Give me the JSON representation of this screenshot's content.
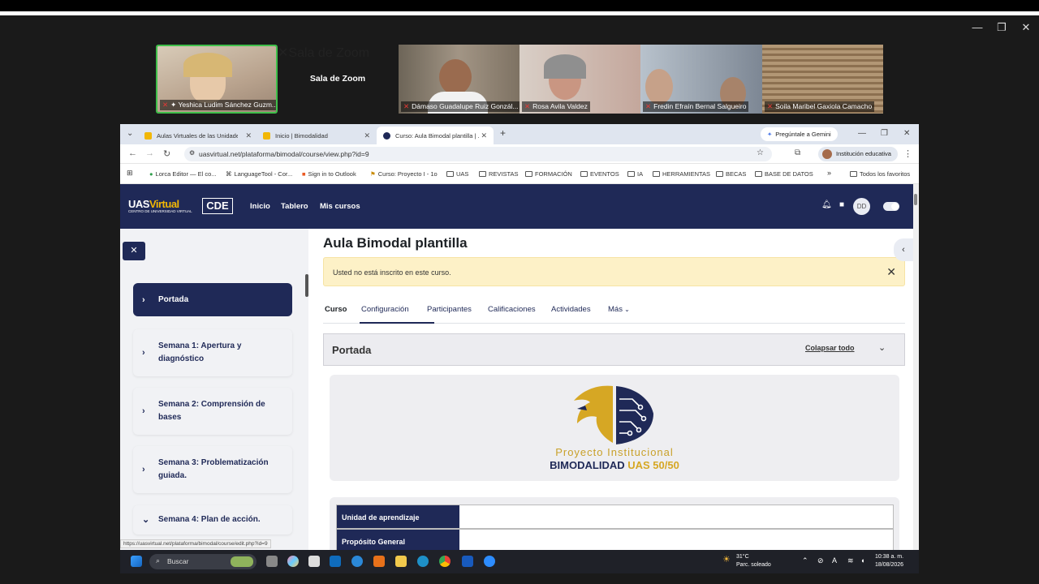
{
  "window_controls": {
    "minimize": "—",
    "restore": "❐",
    "close": "✕"
  },
  "zoom": {
    "room_label": "Sala de Zoom",
    "participants": [
      {
        "name": "Yeshica Ludim Sánchez Guzm...",
        "pinned": true,
        "active": true,
        "color": "#b9a38e"
      },
      {
        "name": "Sala de Zoom",
        "pinned": false,
        "active": false,
        "color": "#1a1a1a"
      },
      {
        "name": "Dámaso Guadalupe Ruiz Gonzál...",
        "pinned": false,
        "active": false,
        "color": "#8d7a66"
      },
      {
        "name": "Rosa Avila Valdez",
        "pinned": false,
        "active": false,
        "color": "#c4a79c"
      },
      {
        "name": "Fredin Efraín Bernal Salgueiro",
        "pinned": false,
        "active": false,
        "color": "#7d8794"
      },
      {
        "name": "Soila Maribel Gaxiola Camacho",
        "pinned": false,
        "active": false,
        "color": "#a08363"
      }
    ]
  },
  "browser": {
    "tabs": [
      {
        "label": "Aulas Virtuales de las Unidades"
      },
      {
        "label": "Inicio | Bimodalidad"
      },
      {
        "label": "Curso: Aula Bimodal plantilla | ..."
      }
    ],
    "new_tab": "+",
    "gemini": "Pregúntale a Gemini",
    "url": "uasvirtual.net/plataforma/bimodal/course/view.php?id=9",
    "profile": "Institución educativa",
    "bookmarks": [
      "Lorca Editor — El co...",
      "LanguageTool - Cor...",
      "Sign in to Outlook",
      "Curso: Proyecto I - 1o",
      "UAS",
      "REVISTAS",
      "FORMACIÓN",
      "EVENTOS",
      "IA",
      "HERRAMIENTAS",
      "BECAS",
      "BASE DE DATOS"
    ],
    "bookmarks_more": "»",
    "all_favorites": "Todos los favoritos",
    "status_url": "https://uasvirtual.net/plataforma/bimodal/course/edit.php?id=9"
  },
  "moodle": {
    "logo_main": "UAS",
    "logo_virtual": "Virtual",
    "logo_sub": "CENTRO DE UNIVERSIDAD VIRTUAL",
    "logo_cde": "CDE",
    "nav": [
      "Inicio",
      "Tablero",
      "Mis cursos"
    ],
    "user_initials": "DD",
    "course_title": "Aula Bimodal plantilla",
    "notice": "Usted no está inscrito en este curso.",
    "course_tabs": [
      "Curso",
      "Configuración",
      "Participantes",
      "Calificaciones",
      "Actividades",
      "Más"
    ],
    "section_title": "Portada",
    "collapse_all": "Colapsar todo",
    "banner_line1": "Proyecto Institucional",
    "banner_line2a": "BIMODALIDAD",
    "banner_line2b": "UAS 50/50",
    "table_rows": [
      "Unidad de aprendizaje",
      "Propósito General"
    ],
    "sidebar": [
      {
        "label": "Portada",
        "active": true
      },
      {
        "label": "Semana 1: Apertura y diagnóstico",
        "active": false
      },
      {
        "label": "Semana 2: Comprensión de bases",
        "active": false
      },
      {
        "label": "Semana 3: Problematización guiada.",
        "active": false
      },
      {
        "label": "Semana 4: Plan de acción.",
        "active": false
      }
    ]
  },
  "taskbar": {
    "search": "Buscar",
    "temp": "31°C",
    "weather": "Parc. soleado",
    "time": "10:38 a. m.",
    "date": "18/08/2026"
  }
}
